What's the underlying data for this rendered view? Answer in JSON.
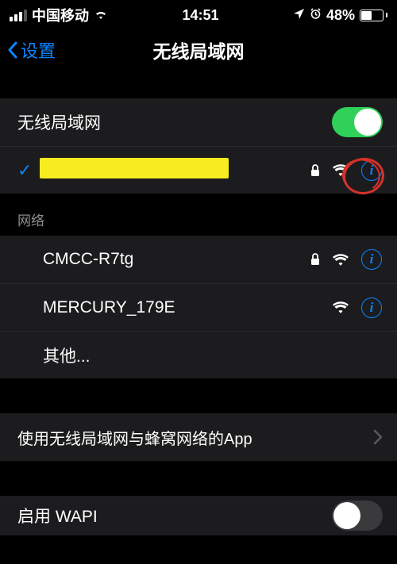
{
  "status": {
    "carrier": "中国移动",
    "time": "14:51",
    "battery_pct": "48%"
  },
  "nav": {
    "back_label": "设置",
    "title": "无线局域网"
  },
  "wifi_toggle": {
    "label": "无线局域网",
    "on": true
  },
  "connected": {
    "name_redacted": true,
    "locked": true
  },
  "networks_header": "网络",
  "networks": [
    {
      "name": "CMCC-R7tg",
      "locked": true
    },
    {
      "name": "MERCURY_179E",
      "locked": false
    }
  ],
  "other_label": "其他...",
  "apps_row": {
    "label": "使用无线局域网与蜂窝网络的App"
  },
  "wapi_row": {
    "label": "启用 WAPI",
    "on": false
  }
}
